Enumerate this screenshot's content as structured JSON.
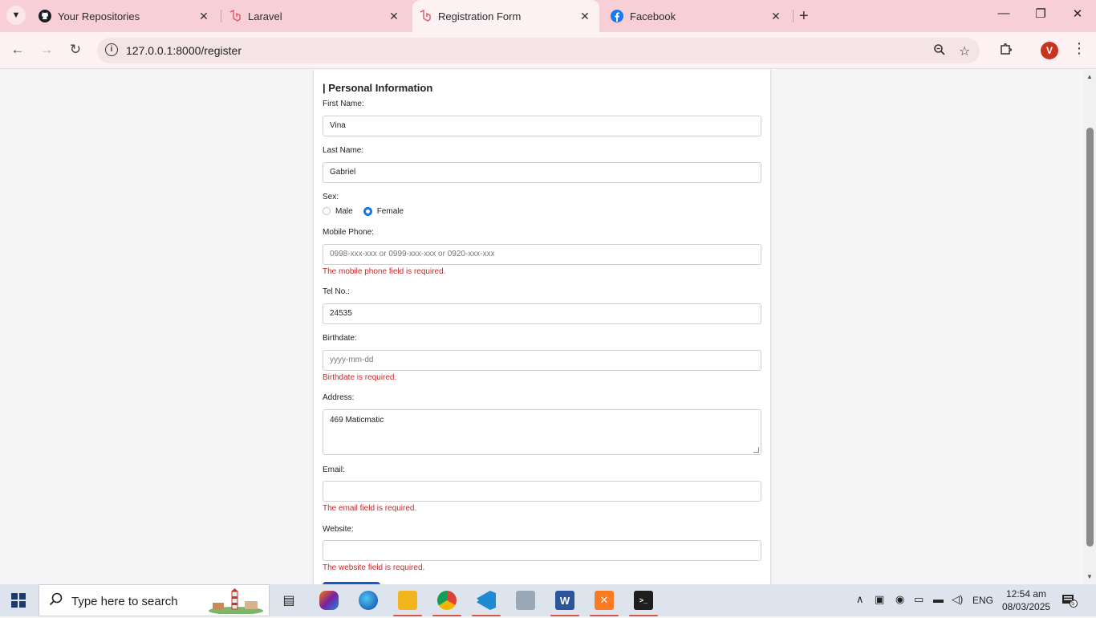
{
  "browser": {
    "tabs": [
      {
        "title": "Your Repositories",
        "icon": "github-icon"
      },
      {
        "title": "Laravel",
        "icon": "laravel-icon"
      },
      {
        "title": "Registration Form",
        "icon": "laravel-icon",
        "active": true
      },
      {
        "title": "Facebook",
        "icon": "facebook-icon"
      }
    ],
    "url": "127.0.0.1:8000/register",
    "profile_initial": "V"
  },
  "form": {
    "section_title": "| Personal Information",
    "first_name": {
      "label": "First Name:",
      "value": "Vina"
    },
    "last_name": {
      "label": "Last Name:",
      "value": "Gabriel"
    },
    "sex": {
      "label": "Sex:",
      "options": [
        "Male",
        "Female"
      ],
      "selected": "Female"
    },
    "mobile_phone": {
      "label": "Mobile Phone:",
      "placeholder": "0998-xxx-xxx or 0999-xxx-xxx or 0920-xxx-xxx",
      "error": "The mobile phone field is required."
    },
    "tel_no": {
      "label": "Tel No.:",
      "value": "24535"
    },
    "birthdate": {
      "label": "Birthdate:",
      "placeholder": "yyyy-mm-dd",
      "error": "Birthdate is required."
    },
    "address": {
      "label": "Address:",
      "value": "469 Maticmatic"
    },
    "email": {
      "label": "Email:",
      "value": "",
      "error": "The email field is required."
    },
    "website": {
      "label": "Website:",
      "value": "",
      "error": "The website field is required."
    }
  },
  "taskbar": {
    "search_placeholder": "Type here to search",
    "tray_lang": "ENG",
    "time": "12:54 am",
    "date": "08/03/2025",
    "notification_count": "5"
  },
  "colors": {
    "tabstrip": "#f9cfd7",
    "error": "#c62828",
    "radio_accent": "#1a73e8"
  }
}
